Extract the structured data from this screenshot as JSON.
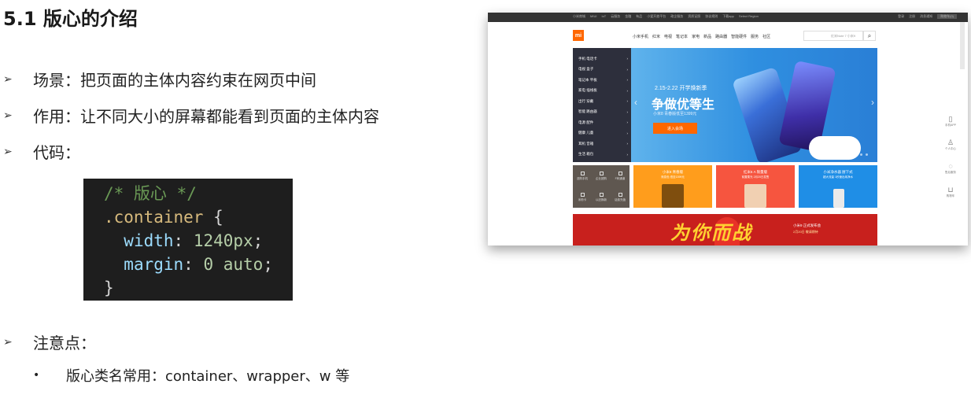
{
  "slide": {
    "title": "5.1 版心的介绍",
    "bullet_marker": "➢",
    "bullets": [
      "场景：把页面的主体内容约束在网页中间",
      "作用：让不同大小的屏幕都能看到页面的主体内容",
      "代码：",
      "注意点："
    ],
    "sub_marker": "•",
    "sub_bullets": [
      "版心类名常用：container、wrapper、w 等"
    ]
  },
  "code": {
    "comment": "/* 版心 */",
    "selector": ".container",
    "open_brace": " {",
    "prop1": "width",
    "val1": "1240px",
    "prop2": "margin",
    "val2": "0 auto",
    "close_brace": "}"
  },
  "screenshot": {
    "topbar_links": [
      "小米商城",
      "MIUI",
      "IoT",
      "云服务",
      "金融",
      "有品",
      "小爱开放平台",
      "政企服务",
      "资质证照",
      "协议规则",
      "下载app",
      "Select Region"
    ],
    "topbar_right": [
      "登录",
      "注册",
      "消息通知"
    ],
    "cart": "购物车(0)",
    "logo": "mi",
    "nav": [
      "小米手机",
      "红米",
      "电视",
      "笔记本",
      "家电",
      "新品",
      "路由器",
      "智能硬件",
      "服务",
      "社区"
    ],
    "search_placeholder": "红米Note 7  小米9",
    "search_icon": "search-icon",
    "categories": [
      "手机 电话卡",
      "电视 盒子",
      "笔记本 平板",
      "家电 插线板",
      "出行 穿戴",
      "智能 路由器",
      "电源 配件",
      "健康 儿童",
      "耳机 音箱",
      "生活 箱包"
    ],
    "banner": {
      "date": "2.15-2.22 开学焕新季",
      "slogan": "争做优等生",
      "desc": "小米8 青春版低至1399元",
      "cta": "进入会场"
    },
    "quick_links": [
      "选购手机",
      "企业团购",
      "F码通道",
      "米粉卡",
      "以旧换新",
      "话费充值"
    ],
    "promos": [
      {
        "title": "小米8 青春版",
        "sub": "渐变色 低至1399元"
      },
      {
        "title": "红米6 A 限量版",
        "sub": "前置柔光 2月20日发售"
      },
      {
        "title": "小米净水器 厨下式",
        "sub": "超大流量 1秒速出纯净水"
      }
    ],
    "red_banner": {
      "title": "为你而战",
      "info1": "小米9 正式发布会",
      "info2": "2月20日 敬请期待"
    },
    "right_bar": [
      "手机APP",
      "个人中心",
      "售后服务",
      "购物车"
    ]
  }
}
